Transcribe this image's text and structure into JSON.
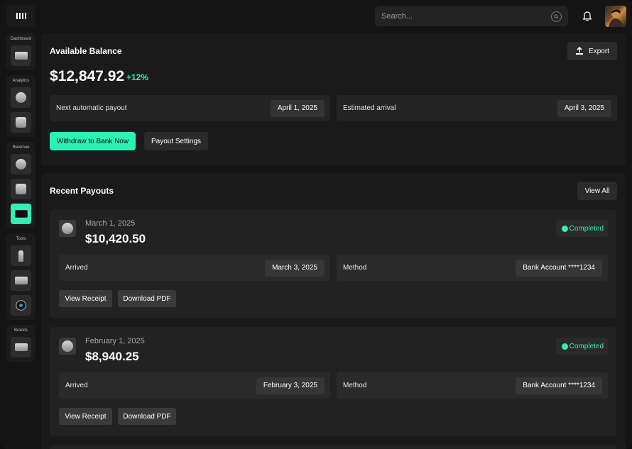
{
  "header": {
    "search_placeholder": "Search...",
    "icons": {
      "logo": "bars-logo-icon",
      "search": "search-icon",
      "bell": "bell-icon",
      "avatar": "user-avatar"
    }
  },
  "sidebar": {
    "groups": [
      {
        "label": "Dashboard",
        "items": [
          "keyboard-icon"
        ]
      },
      {
        "label": "Analytics",
        "items": [
          "globe-icon",
          "card-icon"
        ]
      },
      {
        "label": "Revenue",
        "items": [
          "coin-icon",
          "megaphone-icon",
          "wallet-icon"
        ]
      },
      {
        "label": "Tools",
        "items": [
          "pin-icon",
          "mail-icon",
          "lens-icon"
        ]
      },
      {
        "label": "Brands",
        "items": [
          "briefcase-icon"
        ]
      }
    ],
    "active_item": "wallet-icon"
  },
  "balance": {
    "title": "Available Balance",
    "export_label": "Export",
    "amount": "$12,847.92",
    "change": "+12%",
    "next_payout_label": "Next automatic payout",
    "next_payout_date": "April 1, 2025",
    "arrival_label": "Estimated arrival",
    "arrival_date": "April 3, 2025",
    "withdraw_label": "Withdraw to Bank Now",
    "settings_label": "Payout Settings"
  },
  "payouts": {
    "title": "Recent Payouts",
    "view_all_label": "View All",
    "items": [
      {
        "date": "March 1, 2025",
        "amount": "$10,420.50",
        "status": "Completed",
        "arrived_label": "Arrived",
        "arrived_date": "March 3, 2025",
        "method_label": "Method",
        "method_value": "Bank Account ****1234",
        "receipt_label": "View Receipt",
        "pdf_label": "Download PDF"
      },
      {
        "date": "February 1, 2025",
        "amount": "$8,940.25",
        "status": "Completed",
        "arrived_label": "Arrived",
        "arrived_date": "February 3, 2025",
        "method_label": "Method",
        "method_value": "Bank Account ****1234",
        "receipt_label": "View Receipt",
        "pdf_label": "Download PDF"
      }
    ]
  },
  "colors": {
    "accent": "#2ef2b4",
    "background": "#141414",
    "card": "#1a1a1a"
  }
}
